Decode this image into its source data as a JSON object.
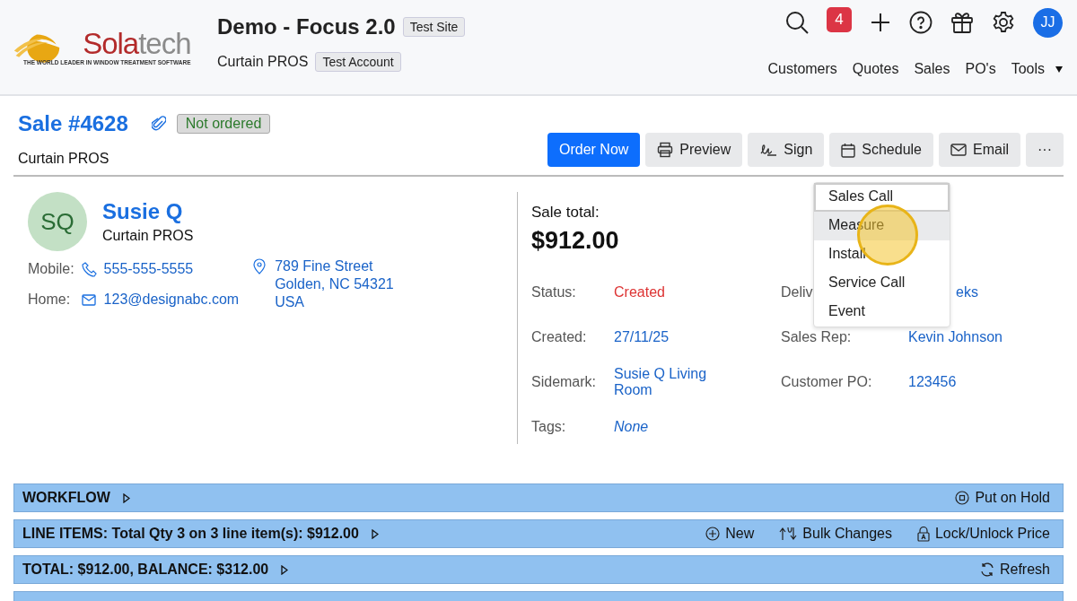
{
  "header": {
    "logo_name": [
      "Sola",
      "tech"
    ],
    "logo_tagline": "THE WORLD LEADER IN WINDOW TREATMENT SOFTWARE",
    "site_title": "Demo - Focus 2.0",
    "site_badge": "Test Site",
    "account": "Curtain PROS",
    "account_badge": "Test Account",
    "notification_count": "4",
    "avatar": "JJ",
    "nav": [
      {
        "label": "Customers",
        "dropdown": false
      },
      {
        "label": "Quotes",
        "dropdown": false
      },
      {
        "label": "Sales",
        "dropdown": false
      },
      {
        "label": "PO's",
        "dropdown": false
      },
      {
        "label": "Tools",
        "dropdown": true
      }
    ]
  },
  "sale": {
    "title": "Sale #4628",
    "status_badge": "Not ordered",
    "company": "Curtain PROS",
    "actions": [
      {
        "label": "Order Now",
        "kind": "primary"
      },
      {
        "label": "Preview",
        "kind": "print"
      },
      {
        "label": "Sign",
        "kind": "sign"
      },
      {
        "label": "Schedule",
        "kind": "calendar"
      },
      {
        "label": "Email",
        "kind": "mail"
      },
      {
        "label": "···",
        "kind": "more"
      }
    ]
  },
  "schedule_menu": [
    {
      "label": "Sales Call",
      "selected": false,
      "focused": true
    },
    {
      "label": "Measure",
      "selected": true,
      "focused": false
    },
    {
      "label": "Install",
      "selected": false,
      "focused": false
    },
    {
      "label": "Service Call",
      "selected": false,
      "focused": false
    },
    {
      "label": "Event",
      "selected": false,
      "focused": false
    }
  ],
  "customer": {
    "initials": "SQ",
    "name": "Susie Q",
    "company": "Curtain PROS",
    "mobile_label": "Mobile:",
    "mobile": "555-555-5555",
    "home_label": "Home:",
    "email": "123@designabc.com",
    "address": [
      "789 Fine Street",
      "Golden, NC 54321",
      "USA"
    ]
  },
  "summary": {
    "total_label": "Sale total:",
    "total": "$912.00",
    "fields": [
      {
        "label": "Status:",
        "value": "Created",
        "kind": "status"
      },
      {
        "label": "Deliv",
        "value": "eks",
        "kind": "link"
      },
      {
        "label": "Created:",
        "value": "27/11/25",
        "kind": "link"
      },
      {
        "label": "Sales Rep:",
        "value": "Kevin Johnson",
        "kind": "link"
      },
      {
        "label": "Sidemark:",
        "value": "Susie Q Living Room",
        "kind": "link"
      },
      {
        "label": "Customer PO:",
        "value": "123456",
        "kind": "link"
      },
      {
        "label": "Tags:",
        "value": "None",
        "kind": "empty"
      }
    ]
  },
  "sections": [
    {
      "title": "WORKFLOW",
      "actions": [
        {
          "label": "Put on Hold",
          "kind": "hold"
        }
      ]
    },
    {
      "title": "LINE ITEMS: Total Qty 3 on 3 line item(s): $912.00",
      "actions": [
        {
          "label": "New",
          "kind": "new"
        },
        {
          "label": "Bulk Changes",
          "kind": "bulk"
        },
        {
          "label": "Lock/Unlock Price",
          "kind": "lock"
        }
      ]
    },
    {
      "title": "TOTAL: $912.00, BALANCE: $312.00",
      "actions": [
        {
          "label": "Refresh",
          "kind": "refresh"
        }
      ]
    }
  ]
}
